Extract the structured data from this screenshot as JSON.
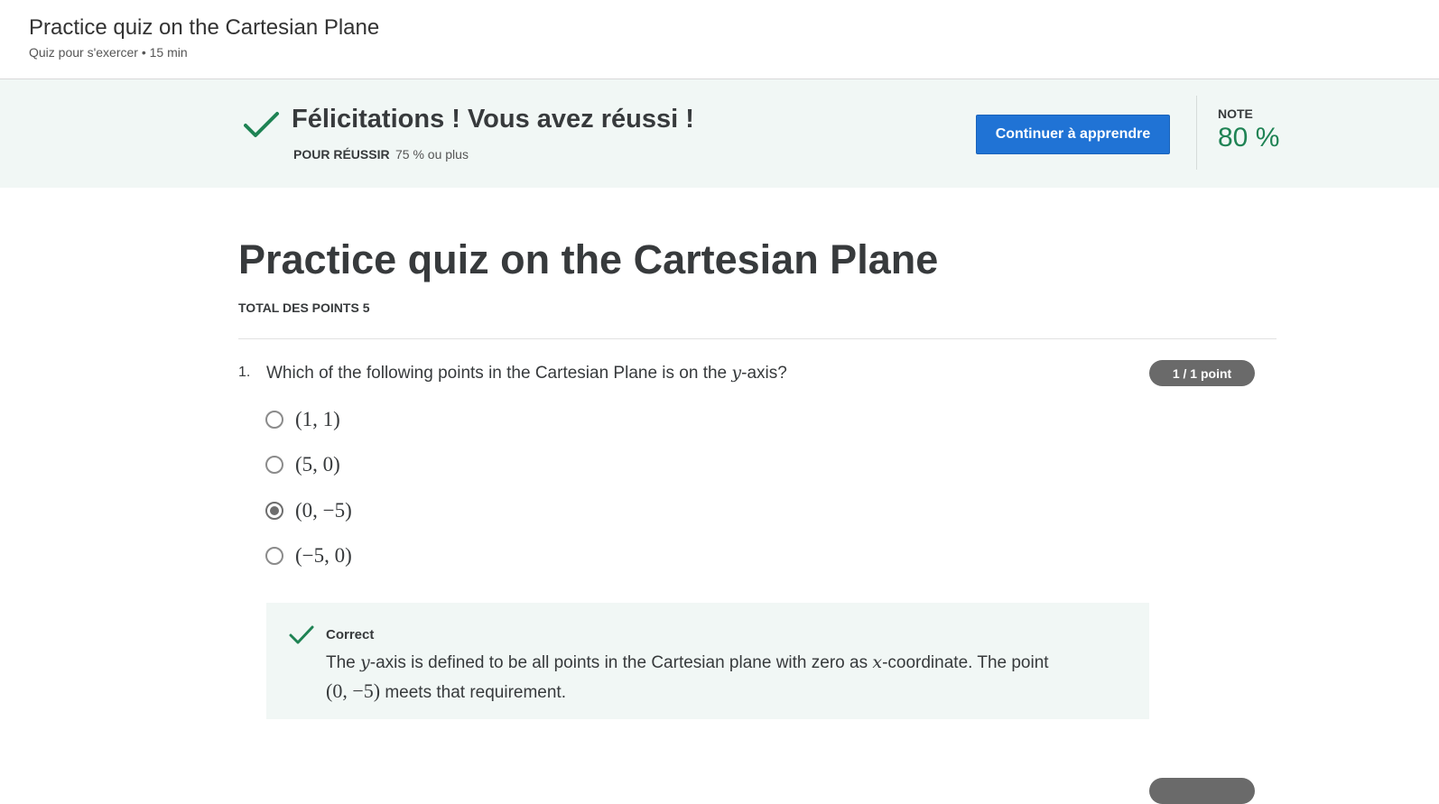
{
  "header": {
    "title": "Practice quiz on the Cartesian Plane",
    "subtitle": "Quiz pour s'exercer • 15 min"
  },
  "banner": {
    "title": "Félicitations ! Vous avez réussi !",
    "pass_label": "POUR RÉUSSIR",
    "pass_value": "75 % ou plus",
    "continue_label": "Continuer à apprendre",
    "grade_label": "NOTE",
    "grade_value": "80 %",
    "accent_color": "#1f8354",
    "button_color": "#2073d5"
  },
  "quiz": {
    "title": "Practice quiz on the Cartesian Plane",
    "total_points_label": "TOTAL DES POINTS",
    "total_points_value": "5"
  },
  "question1": {
    "number": "1.",
    "text_before": "Which of the following points in the Cartesian Plane is on the",
    "var": "y",
    "text_after": "-axis?",
    "points_badge": "1 / 1 point",
    "options": [
      {
        "label": "(1, 1)",
        "selected": false
      },
      {
        "label": "(5, 0)",
        "selected": false
      },
      {
        "label": "(0, −5)",
        "selected": true
      },
      {
        "label": "(−5, 0)",
        "selected": false
      }
    ],
    "feedback": {
      "title": "Correct",
      "part1": "The",
      "var1": "y",
      "part2": "-axis is defined to be all points in the Cartesian plane with zero as",
      "var2": "x",
      "part3": "-coordinate. The point",
      "point": "(0, −5)",
      "part4": "meets that requirement."
    }
  }
}
